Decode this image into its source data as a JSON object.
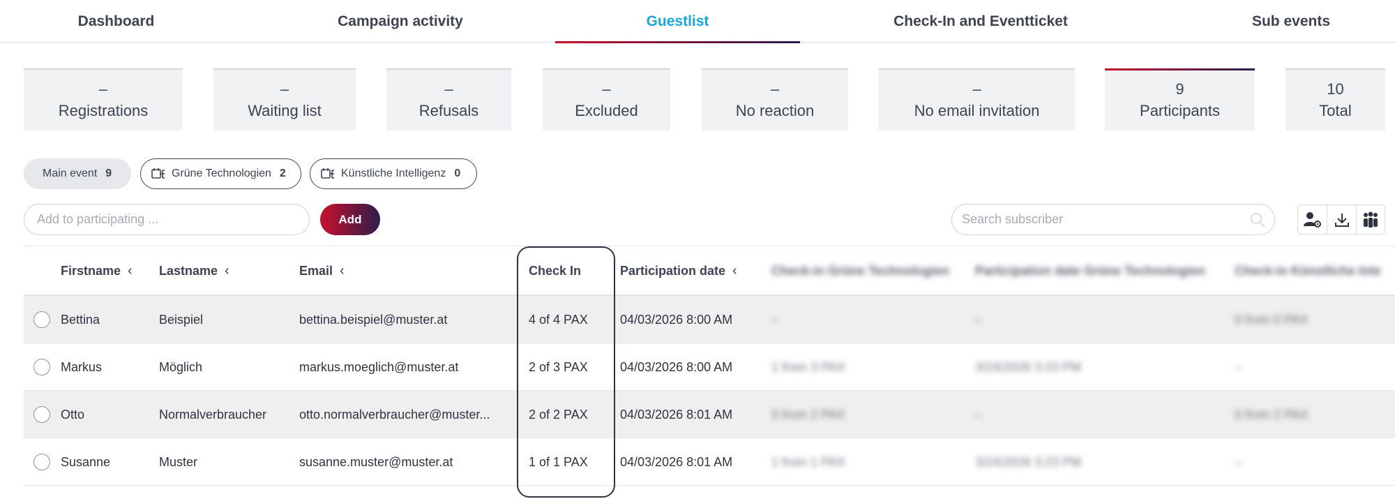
{
  "top_tabs": [
    "Dashboard",
    "Campaign activity",
    "Guestlist",
    "Check-In and Eventticket",
    "Sub events"
  ],
  "active_top_tab": "Guestlist",
  "status_cards": [
    {
      "count": "–",
      "label": "Registrations"
    },
    {
      "count": "–",
      "label": "Waiting list"
    },
    {
      "count": "–",
      "label": "Refusals"
    },
    {
      "count": "–",
      "label": "Excluded"
    },
    {
      "count": "–",
      "label": "No reaction"
    },
    {
      "count": "–",
      "label": "No email invitation"
    },
    {
      "count": "9",
      "label": "Participants"
    },
    {
      "count": "10",
      "label": "Total"
    }
  ],
  "active_status": "Participants",
  "event_chips": [
    {
      "label": "Main event",
      "count": "9",
      "icon": null
    },
    {
      "label": "Grüne Technologien",
      "count": "2",
      "icon": "sub-event-icon"
    },
    {
      "label": "Künstliche Intelligenz",
      "count": "0",
      "icon": "sub-event-icon"
    }
  ],
  "add": {
    "placeholder": "Add to participating ...",
    "button_label": "Add"
  },
  "search": {
    "placeholder": "Search subscriber"
  },
  "tools": [
    "user-settings-icon",
    "download-icon",
    "group-icon"
  ],
  "table": {
    "columns": {
      "firstname": "Firstname",
      "lastname": "Lastname",
      "email": "Email",
      "checkin": "Check In",
      "participation_date": "Participation date",
      "blur1": "Check-in Grüne Technologien",
      "blur2": "Participation date Grüne Technologien",
      "blur3": "Check-in Künstliche Inte"
    },
    "rows": [
      {
        "firstname": "Bettina",
        "lastname": "Beispiel",
        "email": "bettina.beispiel@muster.at",
        "checkin": "4 of 4 PAX",
        "participation_date": "04/03/2026 8:00 AM",
        "blur1": "–",
        "blur2": "–",
        "blur3": "0 from 0 PAX"
      },
      {
        "firstname": "Markus",
        "lastname": "Möglich",
        "email": "markus.moeglich@muster.at",
        "checkin": "2 of 3 PAX",
        "participation_date": "04/03/2026 8:00 AM",
        "blur1": "1 from 3 PAX",
        "blur2": "3/24/2026 3:23 PM",
        "blur3": "–"
      },
      {
        "firstname": "Otto",
        "lastname": "Normalverbraucher",
        "email": "otto.normalverbraucher@muster...",
        "checkin": "2 of 2 PAX",
        "participation_date": "04/03/2026 8:01 AM",
        "blur1": "0 from 2 PAX",
        "blur2": "–",
        "blur3": "0 from 2 PAX"
      },
      {
        "firstname": "Susanne",
        "lastname": "Muster",
        "email": "susanne.muster@muster.at",
        "checkin": "1 of 1 PAX",
        "participation_date": "04/03/2026 8:01 AM",
        "blur1": "1 from 1 PAX",
        "blur2": "3/24/2026 3:23 PM",
        "blur3": "–"
      }
    ]
  },
  "colors": {
    "accent_blue": "#1aa6d8",
    "brand_red": "#c8102e",
    "brand_dark": "#2b1e4a"
  }
}
